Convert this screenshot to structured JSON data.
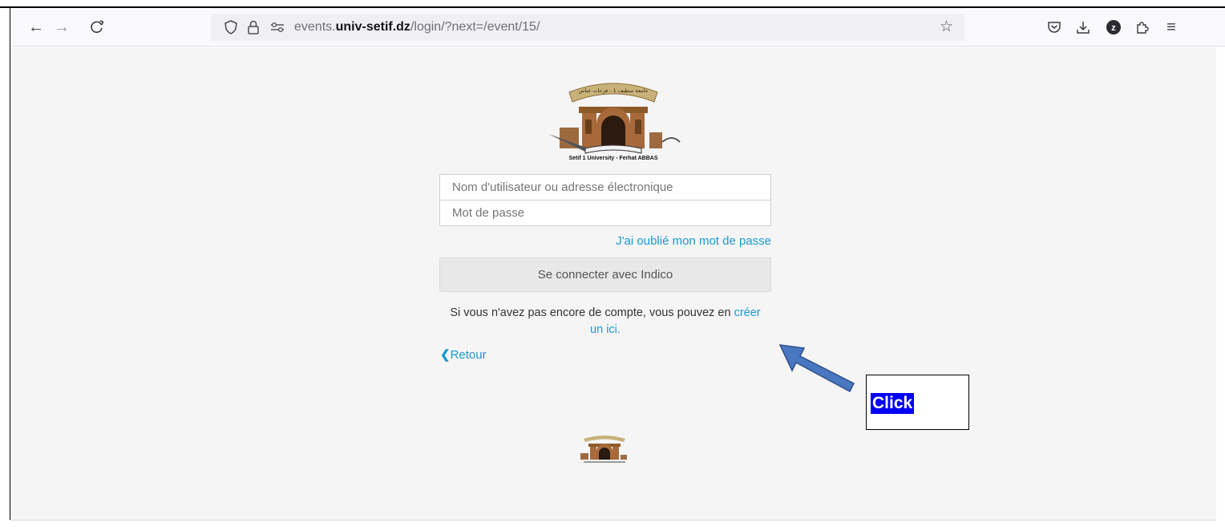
{
  "browser": {
    "url_prefix": "events.",
    "url_domain": "univ-setif.dz",
    "url_path": "/login/?next=/event/15/",
    "icons": [
      "back-arrow-icon",
      "forward-arrow-icon",
      "reload-icon",
      "shield-icon",
      "lock-icon",
      "permissions-icon",
      "star-icon",
      "pocket-icon",
      "download-icon",
      "profile-icon",
      "extensions-icon",
      "menu-icon"
    ],
    "profile_initial": "z"
  },
  "logo": {
    "caption": "Setif 1 University - Ferhat ABBAS",
    "banner_text": "جامعة سطيف 1 - فرحات عباس"
  },
  "login": {
    "username_placeholder": "Nom d'utilisateur ou adresse électronique",
    "password_placeholder": "Mot de passe",
    "forgot_link": "J'ai oublié mon mot de passe",
    "login_button": "Se connecter avec Indico",
    "signup_text": "Si vous n'avez pas encore de compte, vous pouvez en ",
    "signup_link_line1": "créer",
    "signup_link_line2": "un ici.",
    "back_link": "Retour"
  },
  "annotation": {
    "label": "Click",
    "label_bg": "#0000f5",
    "arrow_color": "#4a78c0"
  },
  "colors": {
    "link": "#1a9ad0",
    "page_bg": "#f5f5f5"
  }
}
